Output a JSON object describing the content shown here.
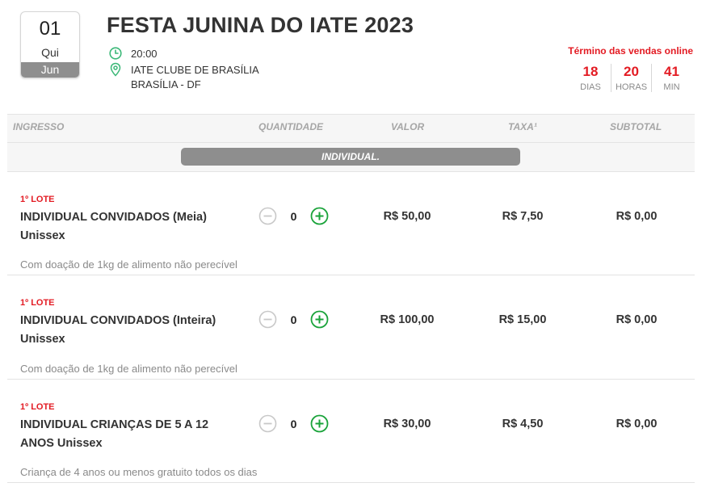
{
  "event": {
    "day": "01",
    "weekday": "Qui",
    "month": "Jun",
    "title": "FESTA JUNINA DO IATE 2023",
    "time": "20:00",
    "venue": "IATE CLUBE DE BRASÍLIA",
    "city": "BRASÍLIA - DF"
  },
  "countdown": {
    "label": "Término das vendas online",
    "days": "18",
    "days_label": "DIAS",
    "hours": "20",
    "hours_label": "HORAS",
    "minutes": "41",
    "minutes_label": "MIN"
  },
  "table": {
    "headers": {
      "ingresso": "INGRESSO",
      "quantidade": "QUANTIDADE",
      "valor": "VALOR",
      "taxa": "TAXA¹",
      "subtotal": "SUBTOTAL"
    },
    "group_label": "INDIVIDUAL.",
    "tickets": [
      {
        "lote": "1º LOTE",
        "name": "INDIVIDUAL CONVIDADOS (Meia) Unissex",
        "quantity": "0",
        "valor": "R$ 50,00",
        "taxa": "R$ 7,50",
        "subtotal": "R$ 0,00",
        "note": "Com doação de 1kg de alimento não perecível"
      },
      {
        "lote": "1º LOTE",
        "name": "INDIVIDUAL CONVIDADOS (Inteira) Unissex",
        "quantity": "0",
        "valor": "R$ 100,00",
        "taxa": "R$ 15,00",
        "subtotal": "R$ 0,00",
        "note": "Com doação de 1kg de alimento não perecível"
      },
      {
        "lote": "1º LOTE",
        "name": "INDIVIDUAL CRIANÇAS DE 5 A 12 ANOS Unissex",
        "quantity": "0",
        "valor": "R$ 30,00",
        "taxa": "R$ 4,50",
        "subtotal": "R$ 0,00",
        "note": "Criança de 4 anos ou menos gratuito  todos os dias"
      }
    ]
  },
  "colors": {
    "accent_red": "#e31b23",
    "plus_green": "#1aa33a",
    "icon_green": "#3cb878",
    "disabled_gray": "#c8c8c8"
  },
  "icons": {
    "time": "clock-icon",
    "place": "map-pin-icon",
    "decrement": "minus-circle-icon",
    "increment": "plus-circle-icon"
  }
}
